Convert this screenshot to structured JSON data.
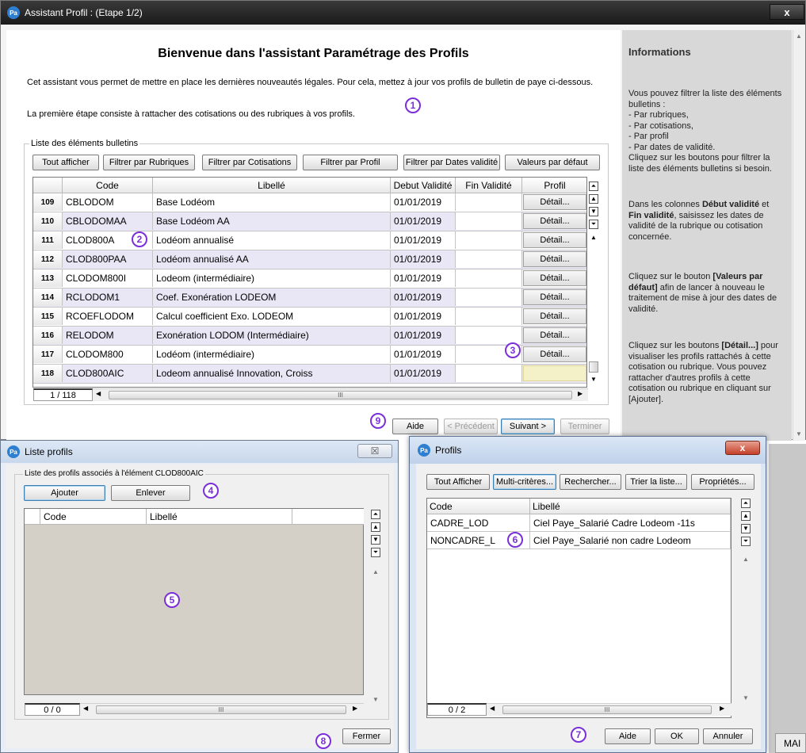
{
  "main_window": {
    "title": "Assistant Profil : (Etape 1/2)",
    "close_glyph": "x",
    "heading": "Bienvenue dans l'assistant Paramétrage des Profils",
    "intro": "Cet assistant vous permet de mettre en place les dernières nouveautés légales. Pour cela, mettez à jour vos profils de bulletin de paye ci-dessous.",
    "step": "La première étape consiste à rattacher des cotisations ou des rubriques à vos profils.",
    "group_label": "Liste des éléments bulletins",
    "filters": {
      "all": "Tout afficher",
      "rubriques": "Filtrer par Rubriques",
      "cotisations": "Filtrer par Cotisations",
      "profil": "Filtrer par Profil",
      "dates": "Filtrer par Dates validité",
      "defaults": "Valeurs par défaut"
    },
    "columns": {
      "code": "Code",
      "libelle": "Libellé",
      "debut": "Debut Validité",
      "fin": "Fin Validité",
      "profil": "Profil"
    },
    "detail_label": "Détail...",
    "rows": [
      {
        "num": "109",
        "code": "CBLODOM",
        "libelle": "Base Lodéom",
        "debut": "01/01/2019"
      },
      {
        "num": "110",
        "code": "CBLODOMAA",
        "libelle": "Base Lodéom AA",
        "debut": "01/01/2019"
      },
      {
        "num": "111",
        "code": "CLOD800A",
        "libelle": "Lodéom annualisé",
        "debut": "01/01/2019"
      },
      {
        "num": "112",
        "code": "CLOD800PAA",
        "libelle": "Lodéom annualisé AA",
        "debut": "01/01/2019"
      },
      {
        "num": "113",
        "code": "CLODOM800I",
        "libelle": "Lodeom (intermédiaire)",
        "debut": "01/01/2019"
      },
      {
        "num": "114",
        "code": "RCLODOM1",
        "libelle": "Coef.  Exonération LODEOM",
        "debut": "01/01/2019"
      },
      {
        "num": "115",
        "code": "RCOEFLODOM",
        "libelle": "Calcul coefficient Exo. LODEOM",
        "debut": "01/01/2019"
      },
      {
        "num": "116",
        "code": "RELODOM",
        "libelle": "Exonération LODOM (Intermédiaire)",
        "debut": "01/01/2019"
      },
      {
        "num": "117",
        "code": "CLODOM800",
        "libelle": "Lodéom (intermédiaire)",
        "debut": "01/01/2019"
      },
      {
        "num": "118",
        "code": "CLOD800AIC",
        "libelle": "Lodeom annualisé Innovation, Croiss",
        "debut": "01/01/2019"
      }
    ],
    "page_counter": "1 / 118",
    "nav": {
      "aide": "Aide",
      "precedent": "< Précédent",
      "suivant": "Suivant >",
      "terminer": "Terminer"
    },
    "scroll_grip": "III"
  },
  "info": {
    "title": "Informations",
    "p1": "Vous pouvez filtrer la liste des éléments bulletins :\n- Par rubriques,\n- Par cotisations,\n- Par profil\n- Par dates de validité.\nCliquez sur les boutons pour filtrer la liste des éléments bulletins si besoin.",
    "p2a": "Dans les colonnes ",
    "p2b": "Début validité",
    "p2c": " et ",
    "p2d": "Fin validité",
    "p2e": ", saisissez les dates de validité de la rubrique ou cotisation concernée.",
    "p3a": "Cliquez sur le bouton ",
    "p3b": "[Valeurs par défaut]",
    "p3c": " afin de lancer à nouveau le traitement de mise à jour des dates de validité.",
    "p4a": "Cliquez sur les boutons ",
    "p4b": "[Détail...]",
    "p4c": " pour visualiser les profils rattachés à cette cotisation ou rubrique. Vous pouvez rattacher d'autres profils à cette cotisation ou rubrique en cliquant sur [Ajouter]."
  },
  "liste_profils": {
    "title": "Liste profils",
    "close_glyph": "☒",
    "group_label": "Liste des profils associés à l'élément CLOD800AIC",
    "ajouter": "Ajouter",
    "enlever": "Enlever",
    "columns": {
      "code": "Code",
      "libelle": "Libellé"
    },
    "page_counter": "0 / 0",
    "fermer": "Fermer"
  },
  "profils": {
    "title": "Profils",
    "close_glyph": "x",
    "buttons": {
      "all": "Tout Afficher",
      "multi": "Multi-critères...",
      "search": "Rechercher...",
      "sort": "Trier la liste...",
      "props": "Propriétés..."
    },
    "columns": {
      "code": "Code",
      "libelle": "Libellé"
    },
    "rows": [
      {
        "code": "CADRE_LOD",
        "libelle": "Ciel Paye_Salarié Cadre Lodeom -11s"
      },
      {
        "code": "NONCADRE_L",
        "libelle": "Ciel Paye_Salarié non cadre Lodeom"
      }
    ],
    "page_counter": "0 / 2",
    "aide": "Aide",
    "ok": "OK",
    "annuler": "Annuler"
  },
  "annotations": [
    "1",
    "2",
    "3",
    "4",
    "5",
    "6",
    "7",
    "8",
    "9"
  ],
  "bg_fragment": "MAI",
  "colors": {
    "accent_circle": "#7b2fd8",
    "alt_row": "#e9e6f5",
    "info_panel": "#d8d8d8",
    "selected_row": "#f4f0c8"
  }
}
